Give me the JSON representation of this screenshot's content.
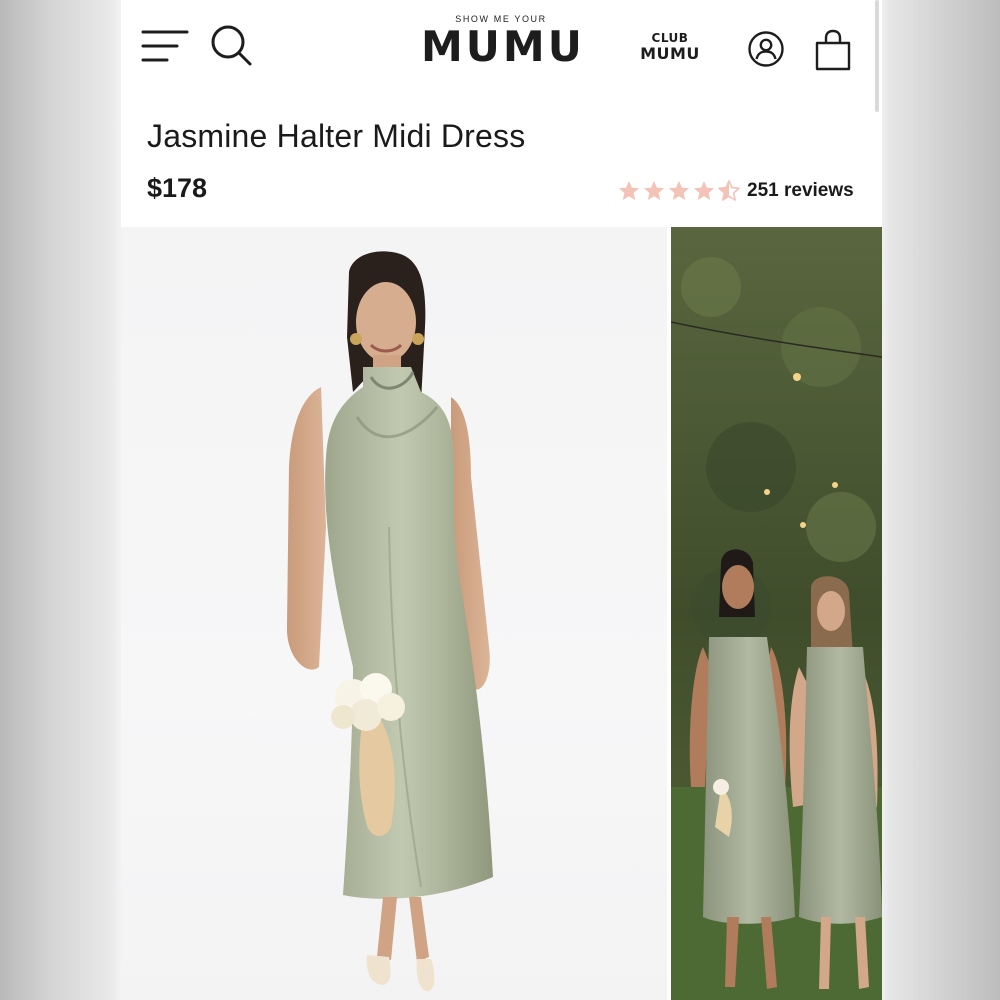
{
  "header": {
    "logo_small": "SHOW ME YOUR",
    "logo_big": "MUMU",
    "club_top": "CLUB",
    "club_bottom": "MUMU",
    "icons": [
      "menu-icon",
      "search-icon",
      "account-icon",
      "shopping-bag-icon"
    ]
  },
  "product": {
    "title": "Jasmine Halter Midi Dress",
    "price": "$178",
    "rating": 4.5,
    "rating_max": 5,
    "reviews": "251 reviews"
  },
  "colors": {
    "star": "#f2c3b6",
    "text": "#1a1a1a",
    "dress_sage": "#a9b397"
  }
}
